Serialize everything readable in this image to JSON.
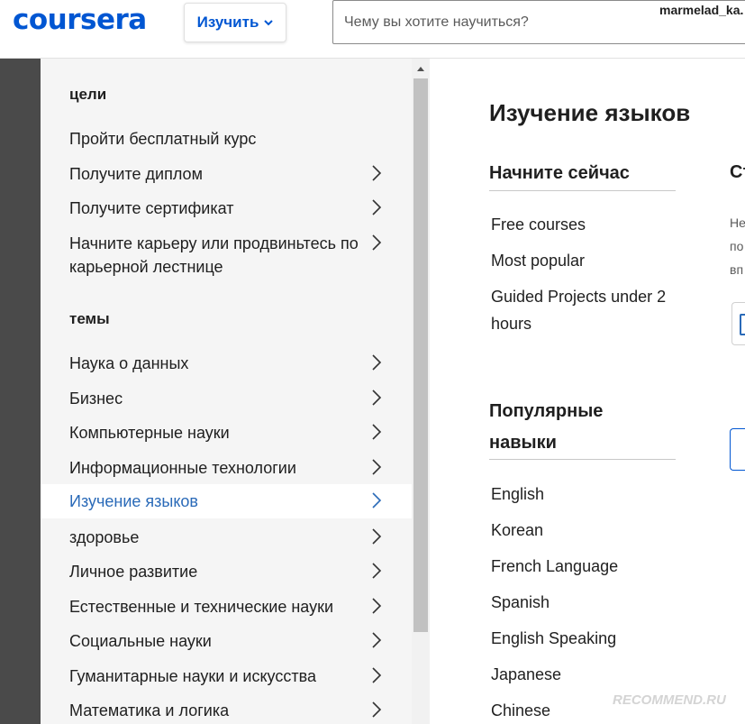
{
  "header": {
    "logo": "coursera",
    "explore_label": "Изучить",
    "search_placeholder": "Чему вы хотите научиться?",
    "username": "marmelad_ka."
  },
  "menu": {
    "goals_heading": "цели",
    "goals": [
      {
        "label": "Пройти бесплатный курс",
        "chevron": false
      },
      {
        "label": "Получите диплом",
        "chevron": true
      },
      {
        "label": "Получите сертификат",
        "chevron": true
      },
      {
        "label_line1": "Начните карьеру или продвиньтесь по",
        "label_line2": "карьерной лестнице",
        "chevron": true
      }
    ],
    "topics_heading": "темы",
    "topics": [
      {
        "label": "Наука о данных"
      },
      {
        "label": "Бизнес"
      },
      {
        "label": "Компьютерные науки"
      },
      {
        "label": "Информационные технологии"
      },
      {
        "label": "Изучение языков",
        "active": true
      },
      {
        "label": "здоровье"
      },
      {
        "label": "Личное развитие"
      },
      {
        "label": "Естественные и технические науки"
      },
      {
        "label": "Социальные науки"
      },
      {
        "label": "Гуманитарные науки и искусства"
      },
      {
        "label": "Математика и логика"
      }
    ]
  },
  "content": {
    "title": "Изучение языков",
    "start_heading": "Начните сейчас",
    "start_links": [
      "Free courses",
      "Most popular",
      "Guided Projects under 2",
      "hours"
    ],
    "skills_heading_line1": "Популярные",
    "skills_heading_line2": "навыки",
    "skills": [
      "English",
      "Korean",
      "French Language",
      "Spanish",
      "English Speaking",
      "Japanese",
      "Chinese"
    ],
    "right_heading": "Ст",
    "right_text": [
      "Не",
      "по",
      "вп"
    ]
  },
  "watermark": "RECOMMEND.RU",
  "colors": {
    "brand": "#0056d2",
    "active_link": "#2a6ab8",
    "sidebar_bg": "#f5f5f5",
    "left_strip": "#4a4a4a"
  }
}
